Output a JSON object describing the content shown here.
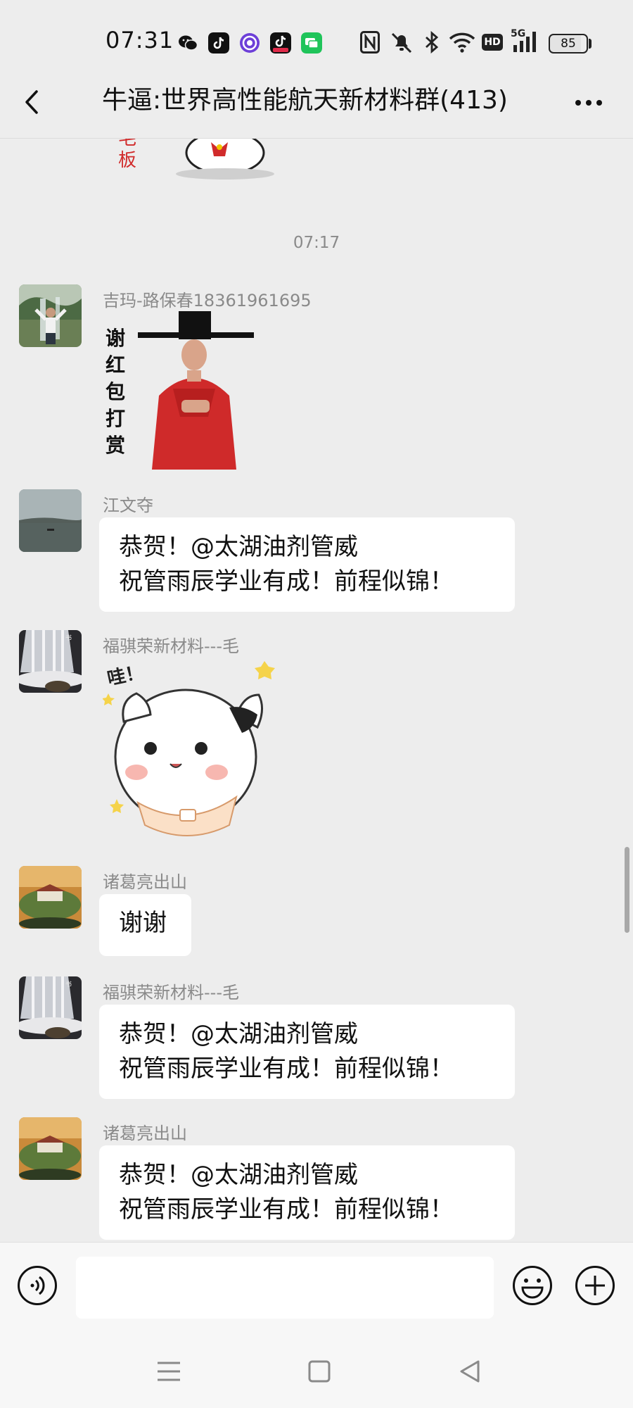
{
  "status_bar": {
    "time": "07:31",
    "battery": "85",
    "network": "5G",
    "hd": "HD",
    "notification_icons": [
      "wechat-icon",
      "tiktok-icon",
      "soul-icon",
      "tiktok-lite-icon",
      "messages-icon"
    ],
    "system_icons": [
      "nfc-icon",
      "mute-icon",
      "bluetooth-icon",
      "wifi-icon",
      "hd-icon",
      "signal-icon",
      "battery-icon"
    ]
  },
  "header": {
    "title": "牛逼:世界高性能航天新材料群(413)"
  },
  "chat": {
    "partial_sticker_text": "板",
    "timestamp": "07:17",
    "messages": [
      {
        "sender": "吉玛-路保春18361961695",
        "type": "sticker",
        "sticker_text": "谢红包打赏"
      },
      {
        "sender": "江文夺",
        "type": "text",
        "lines": [
          "恭贺！@太湖油剂管威",
          "祝管雨辰学业有成！前程似锦！"
        ]
      },
      {
        "sender": "福骐荣新材料---毛",
        "type": "sticker",
        "sticker_text": "哇！"
      },
      {
        "sender": "诸葛亮出山",
        "type": "text",
        "lines": [
          "谢谢"
        ]
      },
      {
        "sender": "福骐荣新材料---毛",
        "type": "text",
        "lines": [
          "恭贺！@太湖油剂管威",
          "祝管雨辰学业有成！前程似锦！"
        ]
      },
      {
        "sender": "诸葛亮出山",
        "type": "text",
        "lines": [
          "恭贺！@太湖油剂管威",
          "祝管雨辰学业有成！前程似锦！"
        ]
      }
    ]
  },
  "input_bar": {
    "placeholder": "",
    "value": ""
  },
  "colors": {
    "background": "#ededed",
    "bubble": "#ffffff",
    "name_text": "#8a8a8a",
    "accent_red": "#d23a2a"
  }
}
